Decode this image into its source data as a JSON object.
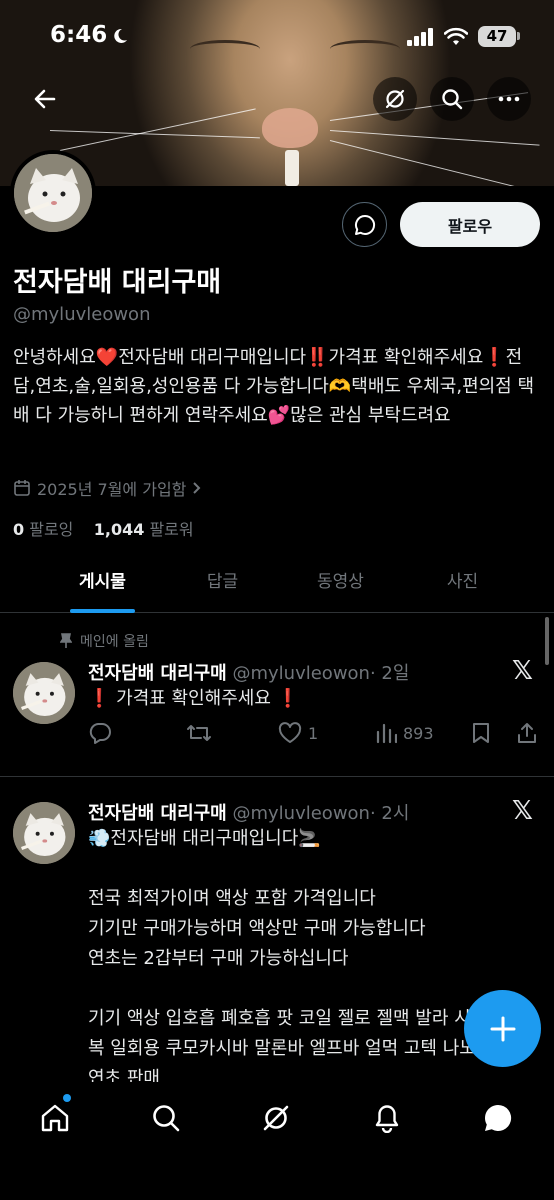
{
  "status_bar": {
    "time": "6:46",
    "battery": "47"
  },
  "profile": {
    "name": "전자담배 대리구매",
    "handle": "@myluvleowon",
    "bio": "안녕하세요❤️전자담배 대리구매입니다‼️가격표 확인해주세요❗️전담,연초,술,일회용,성인용품 다 가능합니다🫶택배도 우체국,편의점 택배 다 가능하니 편하게 연락주세요💕많은 관심 부탁드려요",
    "joined": "2025년 7월에 가입함",
    "following_count": "0",
    "following_label": "팔로잉",
    "followers_count": "1,044",
    "followers_label": "팔로워",
    "follow_button": "팔로우"
  },
  "tabs": [
    {
      "label": "게시물",
      "active": true
    },
    {
      "label": "답글",
      "active": false
    },
    {
      "label": "동영상",
      "active": false
    },
    {
      "label": "사진",
      "active": false
    }
  ],
  "posts": [
    {
      "pinned_label": "메인에 올림",
      "author": "전자담배 대리구매",
      "handle": "@myluvleowon",
      "time": "· 2일",
      "text": "❗️ 가격표 확인해주세요 ❗️",
      "likes": "1",
      "views": "893"
    },
    {
      "author": "전자담배 대리구매",
      "handle": "@myluvleowon",
      "time": "· 2시",
      "text": "💨전자담배 대리구매입니다🚬\n\n전국 최적가이며 액상 포함 가격입니다\n기기만 구매가능하며 액상만 구매 가능합니다\n연초는 2갑부터 구매 가능하십니다\n\n기기 액상 입호흡 폐호흡 팟 코일 젤로 젤맥 발라 시가맥 하복 일회용 쿠모카시바 말론바 엘프바 얼먹 고텍 나노 버블몬 연초 판매"
    }
  ],
  "colors": {
    "accent": "#1d9bf0",
    "muted": "#71767b",
    "divider": "#2f3336"
  }
}
